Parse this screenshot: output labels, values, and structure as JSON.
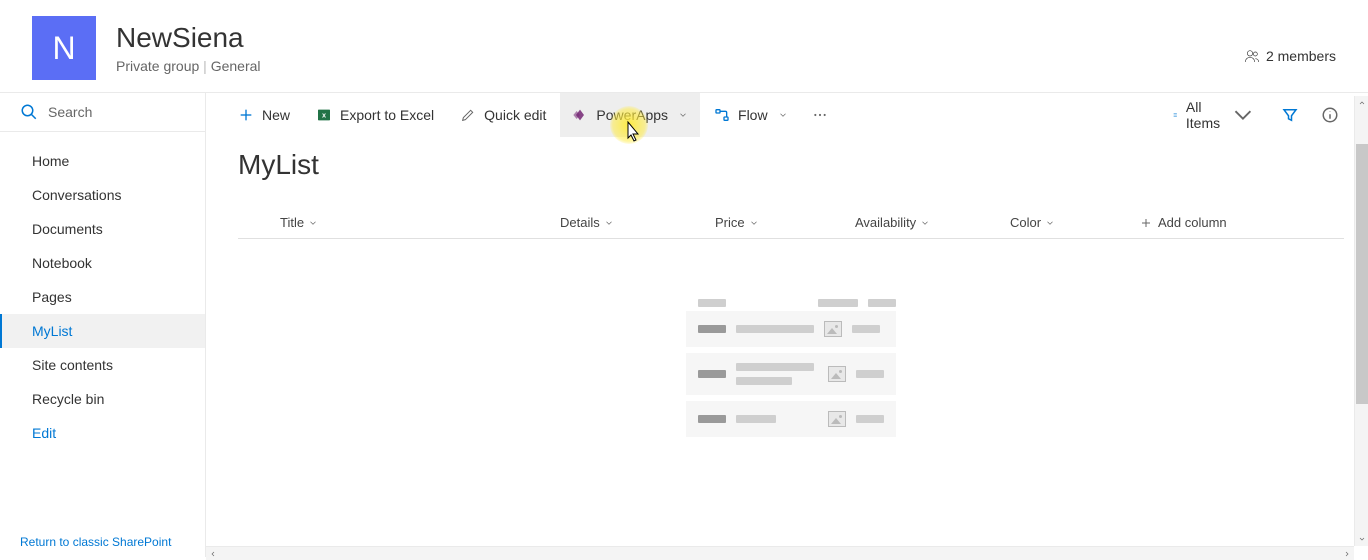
{
  "header": {
    "logo_letter": "N",
    "title": "NewSiena",
    "group_type": "Private group",
    "separator": " | ",
    "access": "General",
    "members_label": "2 members"
  },
  "search": {
    "placeholder": "Search"
  },
  "nav": {
    "items": [
      {
        "label": "Home",
        "active": false
      },
      {
        "label": "Conversations",
        "active": false
      },
      {
        "label": "Documents",
        "active": false
      },
      {
        "label": "Notebook",
        "active": false
      },
      {
        "label": "Pages",
        "active": false
      },
      {
        "label": "MyList",
        "active": true
      },
      {
        "label": "Site contents",
        "active": false
      },
      {
        "label": "Recycle bin",
        "active": false
      },
      {
        "label": "Edit",
        "active": false,
        "link": true
      }
    ],
    "classic_link": "Return to classic SharePoint"
  },
  "cmdbar": {
    "new": "New",
    "export": "Export to Excel",
    "quickedit": "Quick edit",
    "powerapps": "PowerApps",
    "flow": "Flow",
    "view": "All Items"
  },
  "list": {
    "title": "MyList",
    "columns": {
      "title": "Title",
      "details": "Details",
      "price": "Price",
      "availability": "Availability",
      "color": "Color",
      "add": "Add column"
    }
  }
}
